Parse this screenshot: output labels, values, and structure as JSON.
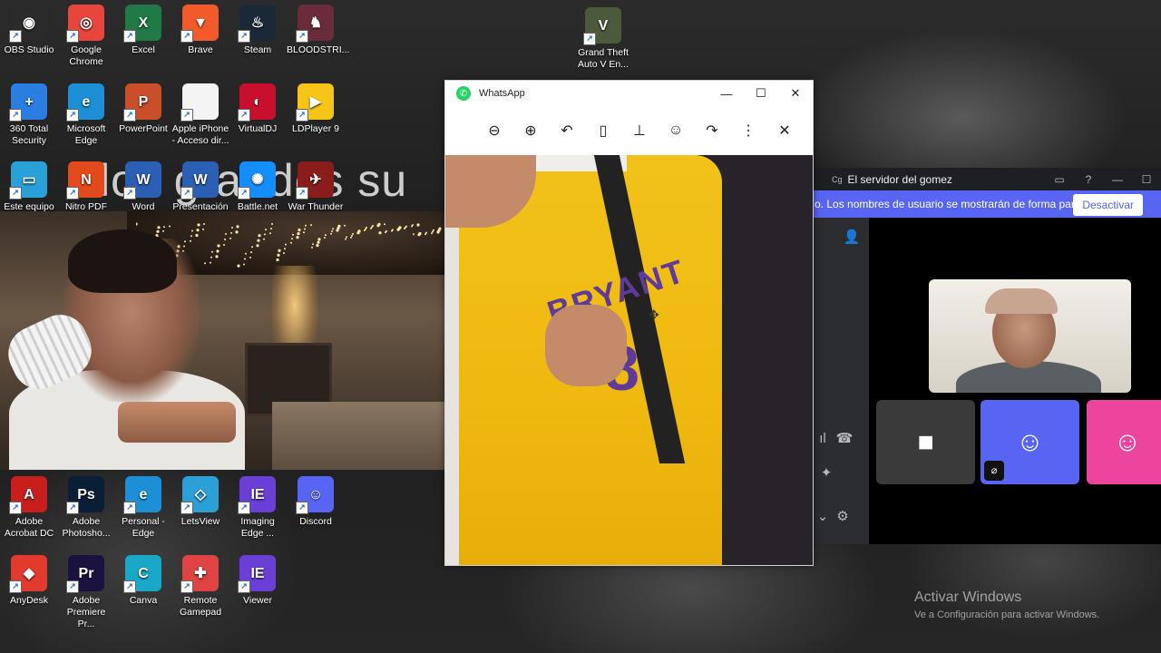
{
  "desktop": {
    "wallpaper_text": "los grandes su",
    "icons": [
      {
        "label": "OBS Studio",
        "color": "#2b2b2b",
        "glyph": "◉"
      },
      {
        "label": "Google Chrome",
        "color": "#e8453c",
        "glyph": "◎"
      },
      {
        "label": "Excel",
        "color": "#1f7a46",
        "glyph": "X"
      },
      {
        "label": "Brave",
        "color": "#f25a29",
        "glyph": "▼"
      },
      {
        "label": "Steam",
        "color": "#1b2838",
        "glyph": "♨"
      },
      {
        "label": "BLOODSTRI...",
        "color": "#6a2b3a",
        "glyph": "♞"
      },
      {
        "label": "Grand Theft Auto V En...",
        "color": "#4a5a3a",
        "glyph": "V"
      },
      {
        "label": "360 Total Security",
        "color": "#2a7de1",
        "glyph": "+"
      },
      {
        "label": "Microsoft Edge",
        "color": "#1c8fd6",
        "glyph": "e"
      },
      {
        "label": "PowerPoint",
        "color": "#c94f2a",
        "glyph": "P"
      },
      {
        "label": "Apple iPhone - Acceso dir...",
        "color": "#f4f4f4",
        "glyph": ""
      },
      {
        "label": "VirtualDJ",
        "color": "#c8102e",
        "glyph": "◐"
      },
      {
        "label": "LDPlayer 9",
        "color": "#f5c518",
        "glyph": "▶"
      },
      {
        "label": "Este equipo",
        "color": "#2aa0d8",
        "glyph": "▭"
      },
      {
        "label": "Nitro PDF Pro",
        "color": "#e24a1b",
        "glyph": "N"
      },
      {
        "label": "Word",
        "color": "#2b5fb4",
        "glyph": "W"
      },
      {
        "label": "Presentación",
        "color": "#2b5fb4",
        "glyph": "W"
      },
      {
        "label": "Battle.net",
        "color": "#148eff",
        "glyph": "✺"
      },
      {
        "label": "War Thunder",
        "color": "#8a1c1c",
        "glyph": "✈"
      },
      {
        "label": "Adobe Acrobat DC",
        "color": "#c91e1e",
        "glyph": "A"
      },
      {
        "label": "Adobe Photosho...",
        "color": "#0a1e36",
        "glyph": "Ps"
      },
      {
        "label": "Personal - Edge",
        "color": "#1c8fd6",
        "glyph": "e"
      },
      {
        "label": "LetsView",
        "color": "#2a9fd8",
        "glyph": "◇"
      },
      {
        "label": "Imaging Edge ...",
        "color": "#6a3fd6",
        "glyph": "IE"
      },
      {
        "label": "Discord",
        "color": "#5865f2",
        "glyph": "☺"
      },
      {
        "label": "AnyDesk",
        "color": "#e23a2f",
        "glyph": "◆"
      },
      {
        "label": "Adobe Premiere Pr...",
        "color": "#1b1240",
        "glyph": "Pr"
      },
      {
        "label": "Canva",
        "color": "#1aa8c9",
        "glyph": "C"
      },
      {
        "label": "Remote Gamepad",
        "color": "#e04343",
        "glyph": "✚"
      },
      {
        "label": "Viewer",
        "color": "#6a3fd6",
        "glyph": "IE"
      }
    ]
  },
  "whatsapp": {
    "title": "WhatsApp",
    "window_buttons": [
      "—",
      "☐",
      "✕"
    ],
    "toolbar_icons": [
      "zoom-out",
      "zoom-in",
      "reply",
      "bookmark",
      "pin",
      "react",
      "forward",
      "more",
      "close"
    ],
    "toolbar_glyphs": [
      "⊖",
      "⊕",
      "↶",
      "▯",
      "⊥",
      "☺",
      "↷",
      "⋮",
      "✕"
    ],
    "photo": {
      "jersey_text": "BRYANT",
      "jersey_number": "8"
    }
  },
  "discord": {
    "server_name": "El servidor del gomez",
    "banner_text": "o. Los nombres de usuario se mostrarán de forma parcial.",
    "banner_button": "Desactivar",
    "accent": "#5865f2",
    "pink": "#eb459e"
  },
  "watermark": {
    "line1": "Activar Windows",
    "line2": "Ve a Configuración para activar Windows."
  }
}
